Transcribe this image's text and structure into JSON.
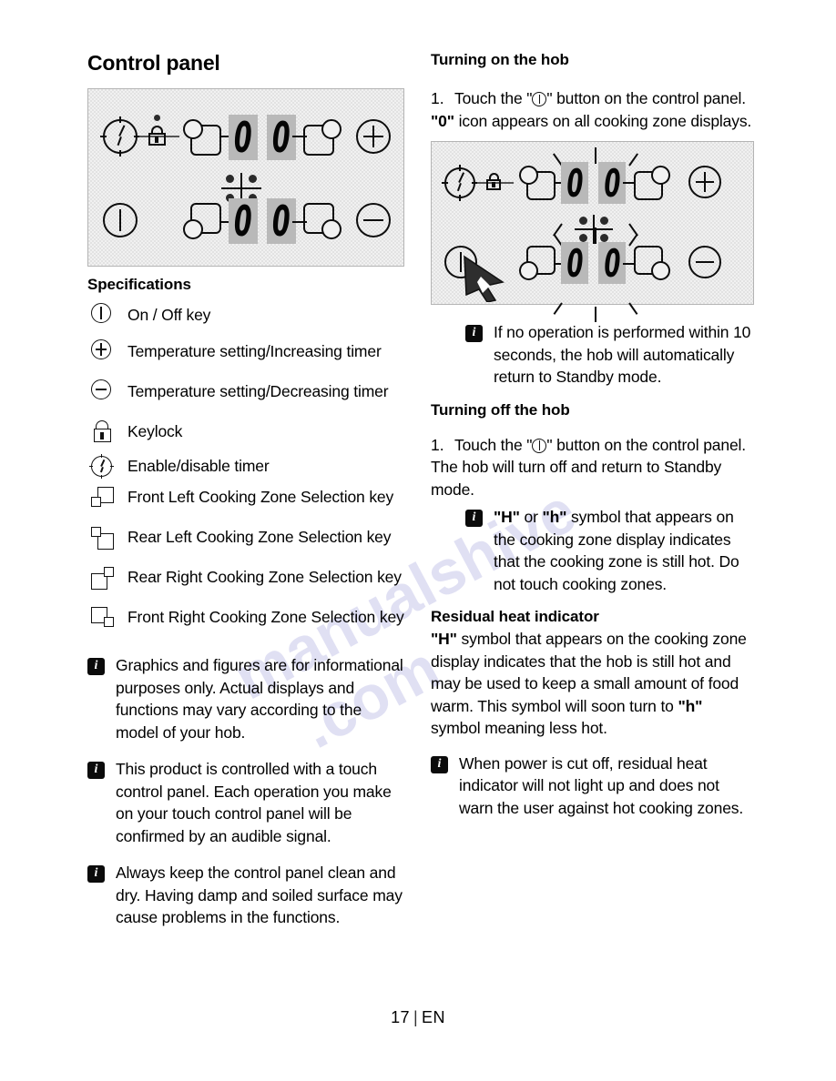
{
  "page": {
    "footer_number": "17",
    "footer_sep": "|",
    "footer_lang": "EN",
    "watermark_line1": "manualshive",
    "watermark_line2": ".com"
  },
  "left": {
    "title": "Control panel",
    "specifications_title": "Specifications",
    "panel_digits": [
      "0",
      "0",
      "0",
      "0"
    ],
    "spec_items": [
      {
        "icon": "on-off-key-icon",
        "label": "On / Off key"
      },
      {
        "icon": "plus-key-icon",
        "label": "Temperature setting/Increasing timer"
      },
      {
        "icon": "minus-key-icon",
        "label": "Temperature setting/Decreasing timer"
      },
      {
        "icon": "keylock-icon",
        "label": "Keylock"
      },
      {
        "icon": "timer-clock-icon",
        "label": "Enable/disable timer"
      },
      {
        "icon": "front-left-zone-icon",
        "label": "Front Left Cooking Zone Selection key"
      },
      {
        "icon": "rear-left-zone-icon",
        "label": "Rear Left Cooking Zone Selection key"
      },
      {
        "icon": "rear-right-zone-icon",
        "label": "Rear Right Cooking Zone Selection key"
      },
      {
        "icon": "front-right-zone-icon",
        "label": "Front Right Cooking Zone Selection key"
      }
    ],
    "notes": [
      "Graphics and figures are for informational purposes only. Actual displays and functions may vary according to the model of your hob.",
      "This product is controlled with a touch control panel. Each operation you make on your touch control panel will be confirmed by an audible signal.",
      "Always keep the control panel clean and dry. Having damp and soiled surface may cause problems in the functions."
    ]
  },
  "right": {
    "turning_on_title": "Turning on the hob",
    "turning_on_step_num": "1.",
    "turning_on_step_a": "Touch the \"",
    "turning_on_step_b": "\" button on the control panel.",
    "turning_on_result_bold": "\"0\"",
    "turning_on_result_rest": " icon appears on all cooking zone displays.",
    "panel_digits": [
      "0",
      "0",
      "0",
      "0"
    ],
    "note_standby": "If no operation is performed within 10 seconds, the hob will automatically return to Standby mode.",
    "turning_off_title": "Turning off the hob",
    "turning_off_step_num": "1.",
    "turning_off_step_a": "Touch the \"",
    "turning_off_step_b": "\" button on the control panel.",
    "turning_off_result": "The hob will turn off and return to Standby mode.",
    "note_hot_b1": "\"H\"",
    "note_hot_m1": " or ",
    "note_hot_b2": "\"h\"",
    "note_hot_rest": " symbol that appears on the cooking zone display indicates that the cooking zone is still hot. Do not touch cooking zones.",
    "residual_title": "Residual heat indicator",
    "residual_b1": "\"H\"",
    "residual_t1": " symbol that appears on the cooking zone display indicates that the hob is still hot and may be used to keep a small amount of food warm. This symbol will soon turn to ",
    "residual_b2": "\"h\"",
    "residual_t2": " symbol meaning less hot.",
    "note_power_cut": "When power is cut off, residual heat indicator will not light up and does not warn the user against hot cooking zones."
  },
  "colors": {
    "ink": "#0d0d0d",
    "panel_bg": "#f1f1f1",
    "digit_bg": "#b9b9b9",
    "watermark": "#9a9ad8"
  }
}
